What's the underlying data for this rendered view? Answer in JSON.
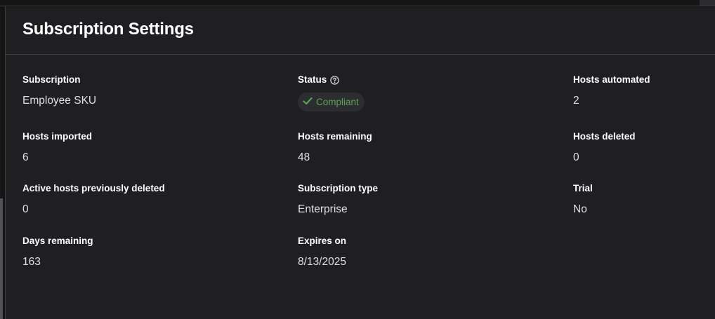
{
  "panel": {
    "title": "Subscription Settings"
  },
  "fields": {
    "subscription": {
      "label": "Subscription",
      "value": "Employee SKU"
    },
    "status": {
      "label": "Status",
      "value": "Compliant",
      "value_color": "#5ba352",
      "icon": "question-circle-icon",
      "badge_icon": "check-icon"
    },
    "hosts_automated": {
      "label": "Hosts automated",
      "value": "2"
    },
    "hosts_imported": {
      "label": "Hosts imported",
      "value": "6"
    },
    "hosts_remaining": {
      "label": "Hosts remaining",
      "value": "48"
    },
    "hosts_deleted": {
      "label": "Hosts deleted",
      "value": "0"
    },
    "active_hosts_previously_deleted": {
      "label": "Active hosts previously deleted",
      "value": "0"
    },
    "subscription_type": {
      "label": "Subscription type",
      "value": "Enterprise"
    },
    "trial": {
      "label": "Trial",
      "value": "No"
    },
    "days_remaining": {
      "label": "Days remaining",
      "value": "163"
    },
    "expires_on": {
      "label": "Expires on",
      "value": "8/13/2025"
    }
  },
  "colors": {
    "background": "#151515",
    "panel": "#1f1f22",
    "divider": "#3c3f42",
    "success": "#5ba352"
  }
}
